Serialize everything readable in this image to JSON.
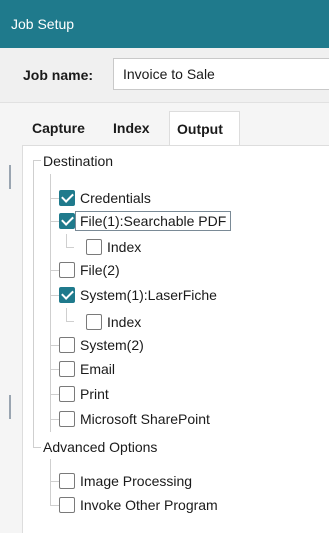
{
  "window": {
    "title": "Job Setup"
  },
  "job": {
    "label": "Job name:",
    "value": "Invoice to Sale"
  },
  "tabs": [
    {
      "label": "Capture"
    },
    {
      "label": "Index"
    },
    {
      "label": "Output"
    }
  ],
  "tree": {
    "destination": "Destination",
    "credentials": {
      "label": "Credentials",
      "checked": true
    },
    "file1": {
      "label": "File(1):Searchable PDF",
      "checked": true
    },
    "file1_index": {
      "label": "Index",
      "checked": false
    },
    "file2": {
      "label": "File(2)",
      "checked": false
    },
    "system1": {
      "label": "System(1):LaserFiche",
      "checked": true
    },
    "system1_index": {
      "label": "Index",
      "checked": false
    },
    "system2": {
      "label": "System(2)",
      "checked": false
    },
    "email": {
      "label": "Email",
      "checked": false
    },
    "print": {
      "label": "Print",
      "checked": false
    },
    "sharepoint": {
      "label": "Microsoft SharePoint",
      "checked": false
    },
    "advanced": "Advanced Options",
    "image_processing": {
      "label": "Image Processing",
      "checked": false
    },
    "invoke_program": {
      "label": "Invoke Other Program",
      "checked": false
    }
  }
}
